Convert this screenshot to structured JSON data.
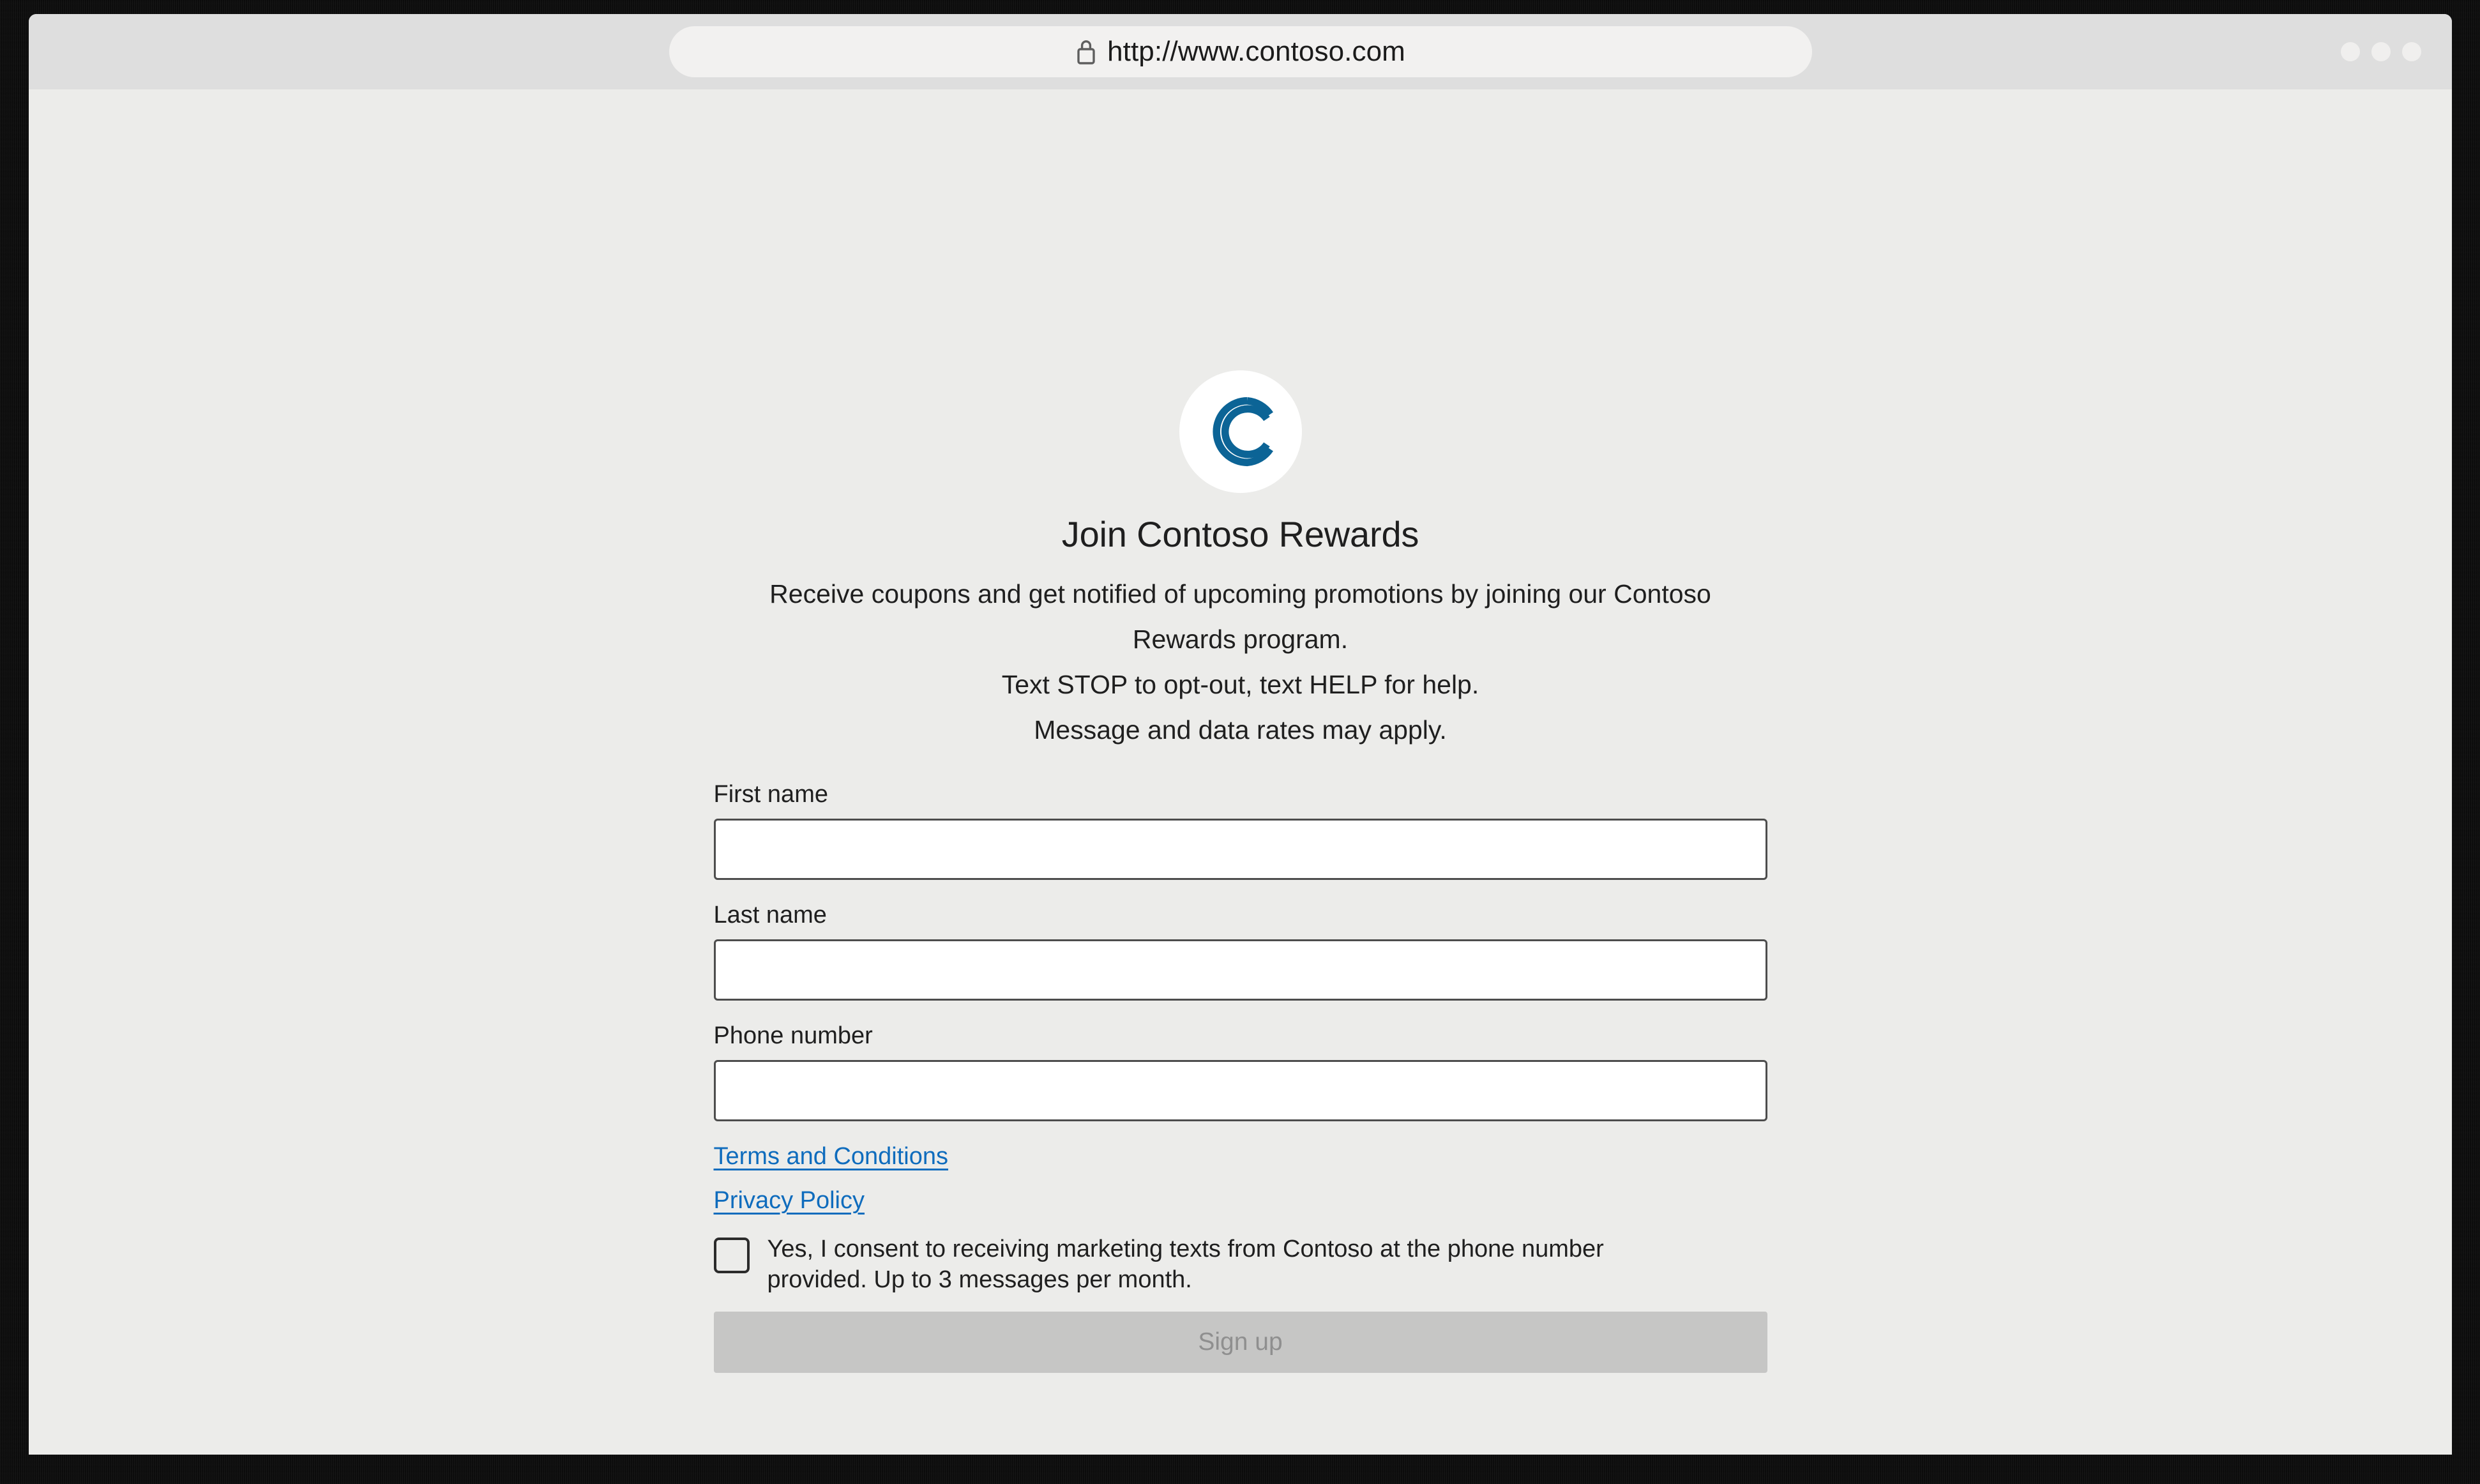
{
  "browser": {
    "url": "http://www.contoso.com",
    "lock_icon": "lock-icon",
    "window_controls": [
      "minimize-dot",
      "maximize-dot",
      "close-dot"
    ]
  },
  "page": {
    "logo_icon": "contoso-double-c-logo",
    "logo_color": "#0c6496",
    "logo_background": "#ffffff",
    "title": "Join Contoso Rewards",
    "intro_lines": [
      "Receive coupons and get notified of upcoming promotions by joining our Contoso",
      "Rewards program.",
      "Text STOP to opt-out, text HELP for help.",
      "Message and data rates may apply."
    ],
    "fields": [
      {
        "label": "First name",
        "value": "",
        "placeholder": ""
      },
      {
        "label": "Last name",
        "value": "",
        "placeholder": ""
      },
      {
        "label": "Phone number",
        "value": "",
        "placeholder": ""
      }
    ],
    "links": [
      {
        "label": "Terms and Conditions"
      },
      {
        "label": "Privacy Policy"
      }
    ],
    "consent": {
      "checked": false,
      "text": "Yes, I consent to receiving marketing texts from Contoso at the phone number provided. Up to 3 messages per month."
    },
    "submit": {
      "label": "Sign up",
      "enabled": false
    },
    "colors": {
      "link": "#0f6cbd",
      "brand_blue": "#0c6496",
      "page_background": "#ececea",
      "titlebar_background": "#dedede",
      "disabled_button": "#c6c6c5",
      "disabled_button_text": "#8f8f8f"
    }
  }
}
